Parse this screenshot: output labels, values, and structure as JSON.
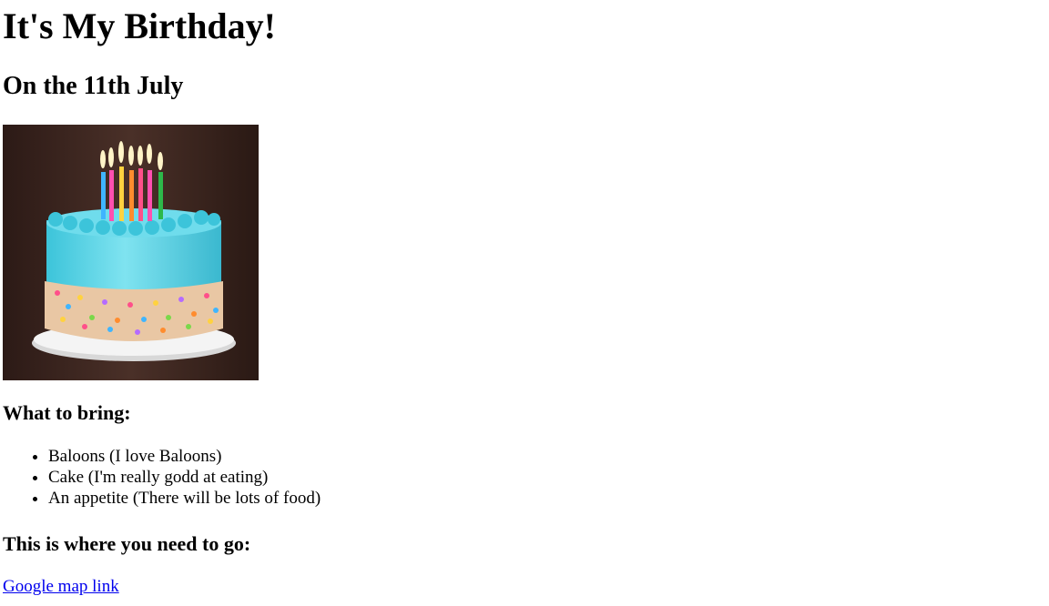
{
  "page": {
    "title": "It's My Birthday!",
    "date_heading": "On the 11th July"
  },
  "bring": {
    "heading": "What to bring:",
    "items": [
      "Baloons (I love Baloons)",
      "Cake (I'm really godd at eating)",
      "An appetite (There will be lots of food)"
    ]
  },
  "directions": {
    "heading": "This is where you need to go:",
    "link_label": "Google map link"
  },
  "image": {
    "icon": "birthday-cake-photo",
    "colors": {
      "background": "#3a2620",
      "frosting": "#54d4e6",
      "plate": "#f2f2f2"
    }
  },
  "colors": {
    "link": "#0000ee",
    "text": "#000000"
  }
}
